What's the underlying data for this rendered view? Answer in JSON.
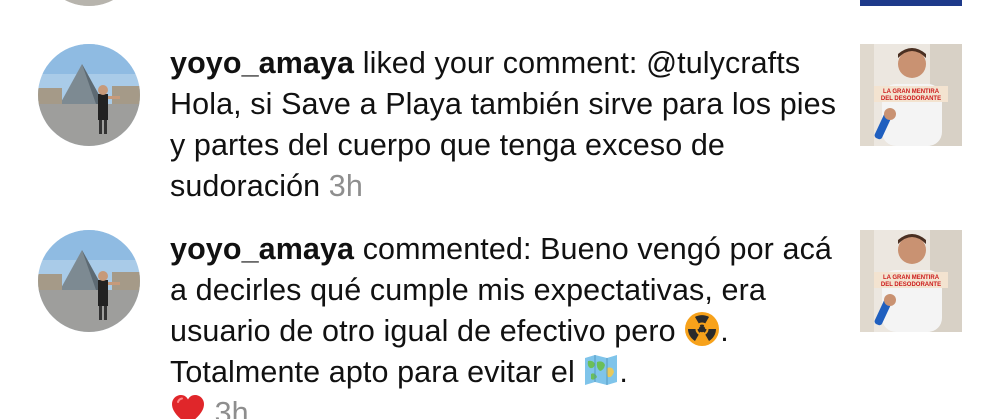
{
  "notifications": [
    {
      "username": "yoyo_amaya",
      "action": "liked your comment:",
      "body": "@tulycrafts Hola, si Save a Playa también sirve para los pies y partes del cuerpo que tenga exceso de sudoración",
      "time": "3h",
      "avatar_icon": "avatar-louvre-photo",
      "thumb_caption": "LA GRAN MENTIRA DEL DESODORANTE"
    },
    {
      "username": "yoyo_amaya",
      "action": "commented:",
      "body_part1": "Bueno vengó por acá a decirles qué cumple mis expectativas, era usuario de otro igual de efectivo pero",
      "emoji_1": "radioactive-emoji",
      "body_part2": ". Totalmente apto para evitar el",
      "emoji_2": "world-map-emoji",
      "body_part3": ".",
      "emoji_3": "red-heart-emoji",
      "time": "3h",
      "avatar_icon": "avatar-louvre-photo",
      "thumb_caption": "LA GRAN MENTIRA DEL DESODORANTE"
    }
  ]
}
